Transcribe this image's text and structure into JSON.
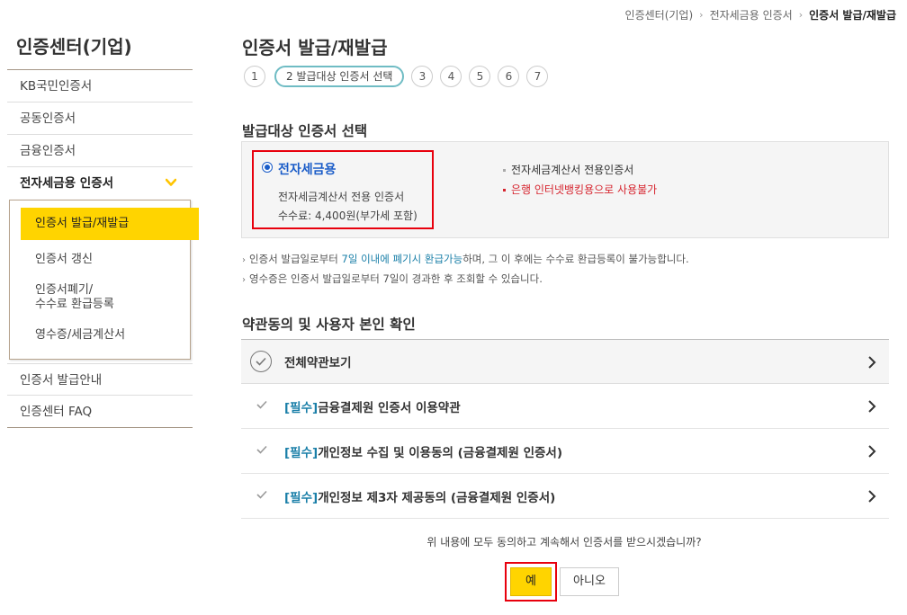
{
  "breadcrumb": {
    "items": [
      "인증센터(기업)",
      "전자세금용 인증서",
      "인증서 발급/재발급"
    ]
  },
  "sidebar": {
    "title": "인증센터(기업)",
    "items": [
      {
        "label": "KB국민인증서"
      },
      {
        "label": "공동인증서"
      },
      {
        "label": "금융인증서"
      },
      {
        "label": "전자세금용 인증서",
        "expanded": true
      },
      {
        "label": "인증서 발급안내"
      },
      {
        "label": "인증센터 FAQ"
      }
    ],
    "sub_items": [
      {
        "label": "인증서 발급/재발급",
        "active": true
      },
      {
        "label": "인증서 갱신"
      },
      {
        "label_line1": "인증서폐기/",
        "label_line2": "수수료 환급등록"
      },
      {
        "label": "영수증/세금계산서"
      }
    ]
  },
  "main": {
    "title": "인증서 발급/재발급",
    "steps": [
      {
        "label": "1"
      },
      {
        "label": "2 발급대상 인증서 선택",
        "active": true
      },
      {
        "label": "3"
      },
      {
        "label": "4"
      },
      {
        "label": "5"
      },
      {
        "label": "6"
      },
      {
        "label": "7"
      }
    ],
    "section1_title": "발급대상 인증서 선택",
    "cert": {
      "name": "전자세금용",
      "desc": "전자세금계산서 전용 인증서",
      "fee": "수수료: 4,400원(부가세 포함)",
      "note1": "전자세금계산서 전용인증서",
      "note2": "은행 인터넷뱅킹용으로 사용불가"
    },
    "info": {
      "line1_a": "인증서 발급일로부터 ",
      "line1_b": "7일 이내에 폐기시 환급가능",
      "line1_c": "하며, 그 이 후에는 수수료 환급등록이 불가능합니다.",
      "line2": "영수증은 인증서 발급일로부터 7일이 경과한 후 조회할 수 있습니다."
    },
    "section2_title": "약관동의 및 사용자 본인 확인",
    "terms": {
      "all_label": "전체약관보기",
      "rows": [
        {
          "tag": "[필수]",
          "label": "금융결제원 인증서 이용약관"
        },
        {
          "tag": "[필수]",
          "label": "개인정보 수집 및 이용동의 (금융결제원 인증서)"
        },
        {
          "tag": "[필수]",
          "label": "개인정보 제3자 제공동의 (금융결제원 인증서)"
        }
      ]
    },
    "confirm_text": "위 내용에 모두 동의하고 계속해서 인증서를 받으시겠습니까?",
    "yes_label": "예",
    "no_label": "아니오"
  },
  "colors": {
    "accent_yellow": "#ffd400",
    "highlight_red": "#e8000d",
    "link_blue": "#1a7fa8",
    "cert_blue": "#1a5cc8",
    "warning_red": "#d6252f"
  }
}
